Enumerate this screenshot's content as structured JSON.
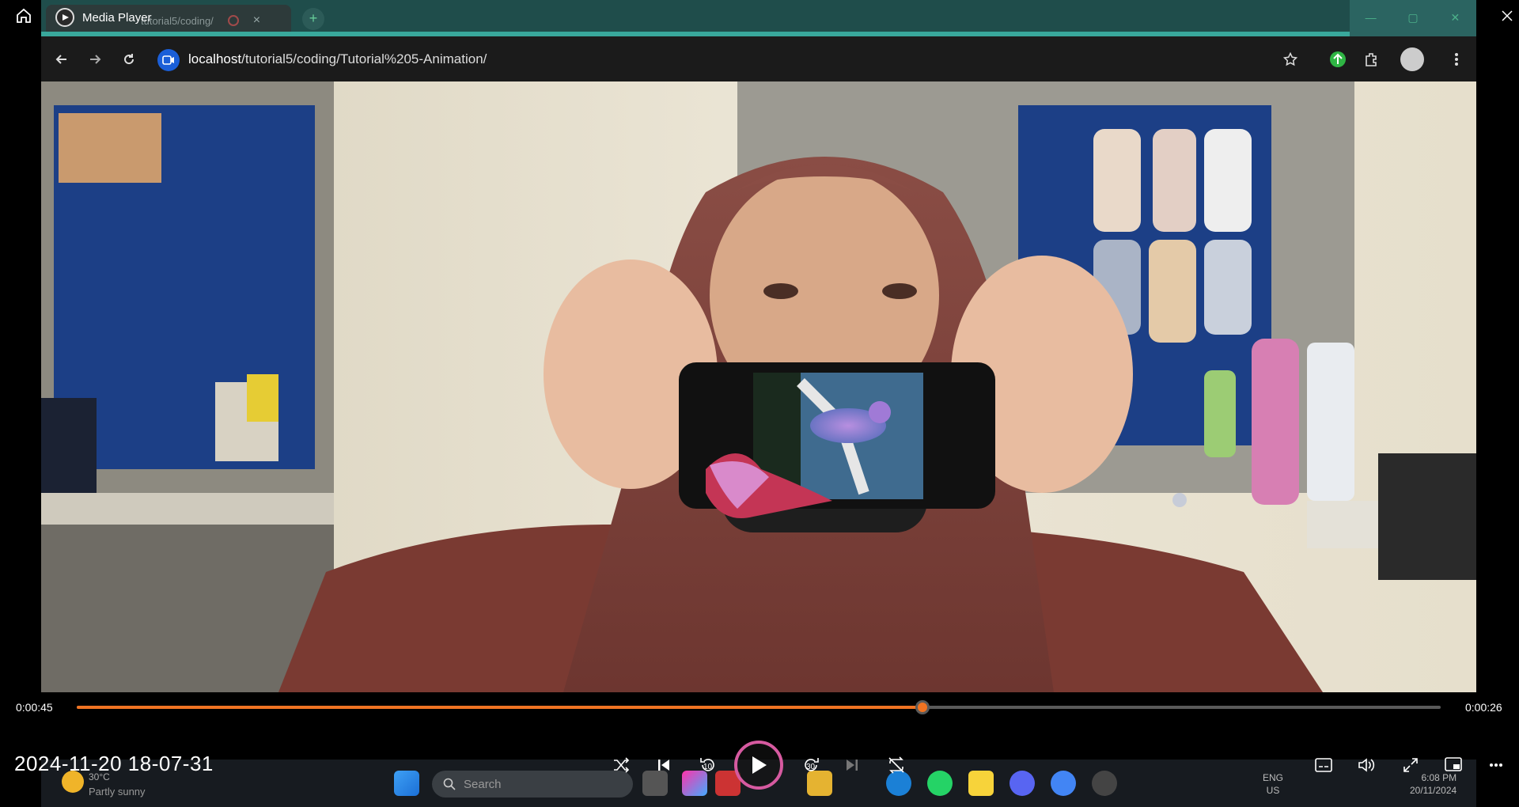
{
  "media_player": {
    "title": "Media Player",
    "elapsed": "0:00:45",
    "remaining": "0:00:26",
    "progress_fraction": 0.62,
    "timestamp_overlay": "2024-11-20 18-07-31",
    "skip_back_seconds": "10",
    "skip_forward_seconds": "30"
  },
  "browser": {
    "tab_title": "tutorial5/coding/",
    "url_host": "localhost",
    "url_path": "/tutorial5/coding/Tutorial%205-Animation/",
    "new_tab_glyph": "+"
  },
  "taskbar": {
    "temperature": "30°C",
    "condition": "Partly sunny",
    "search_label": "Search",
    "language_line1": "ENG",
    "language_line2": "US",
    "clock_time": "6:08 PM",
    "clock_date": "20/11/2024"
  },
  "colors": {
    "accent": "#f07322",
    "play_ring": "#d65aa0",
    "tab_teal": "#1f4d4b"
  },
  "icons": [
    "home-icon",
    "back-icon",
    "forward-icon",
    "reload-icon",
    "star-icon",
    "extensions-icon",
    "menu-icon",
    "shuffle-icon",
    "previous-icon",
    "replay-10-icon",
    "play-icon",
    "forward-30-icon",
    "next-icon",
    "repeat-icon",
    "subtitles-icon",
    "volume-icon",
    "fullscreen-icon",
    "mini-player-icon",
    "more-icon"
  ]
}
